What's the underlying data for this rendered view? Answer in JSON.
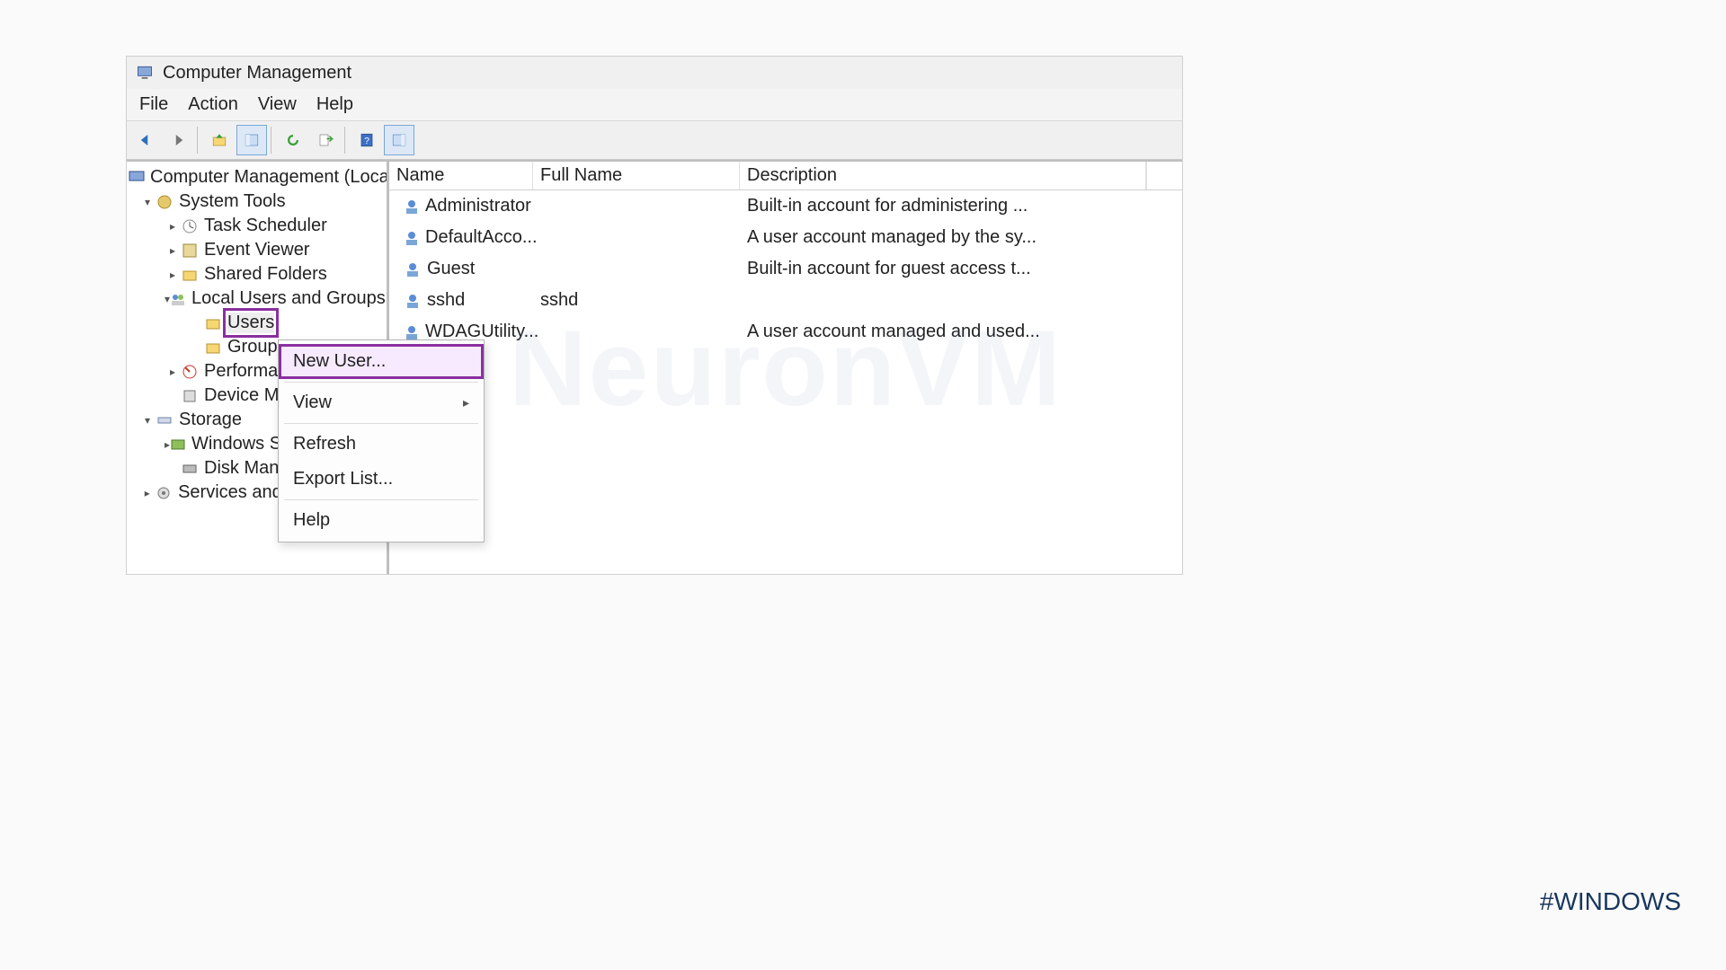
{
  "window": {
    "title": "Computer Management"
  },
  "menubar": {
    "file": "File",
    "action": "Action",
    "view": "View",
    "help": "Help"
  },
  "tree": {
    "root": "Computer Management (Local)",
    "system_tools": "System Tools",
    "task_scheduler": "Task Scheduler",
    "event_viewer": "Event Viewer",
    "shared_folders": "Shared Folders",
    "local_users": "Local Users and Groups",
    "users": "Users",
    "groups": "Groups",
    "performance": "Performance",
    "device_manager": "Device Manager",
    "storage": "Storage",
    "windows_backup": "Windows Server Backup",
    "disk_mgmt": "Disk Management",
    "services": "Services and Applications"
  },
  "columns": {
    "name": "Name",
    "full_name": "Full Name",
    "description": "Description"
  },
  "users": [
    {
      "name": "Administrator",
      "full": "",
      "desc": "Built-in account for administering ..."
    },
    {
      "name": "DefaultAcco...",
      "full": "",
      "desc": "A user account managed by the sy..."
    },
    {
      "name": "Guest",
      "full": "",
      "desc": "Built-in account for guest access t..."
    },
    {
      "name": "sshd",
      "full": "sshd",
      "desc": ""
    },
    {
      "name": "WDAGUtility...",
      "full": "",
      "desc": "A user account managed and used..."
    }
  ],
  "context_menu": {
    "new_user": "New User...",
    "view": "View",
    "refresh": "Refresh",
    "export": "Export List...",
    "help": "Help"
  },
  "watermark": "NeuronVM",
  "hashtag": "#WINDOWS"
}
